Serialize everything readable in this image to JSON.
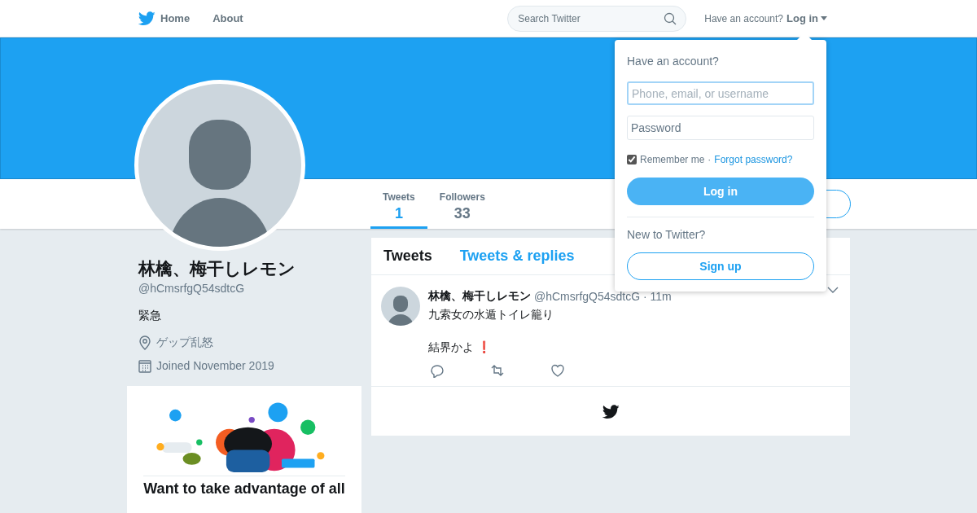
{
  "nav": {
    "items": [
      {
        "label": "Home",
        "kind": "home"
      },
      {
        "label": "About",
        "kind": "plain"
      }
    ],
    "search": {
      "placeholder": "Search Twitter"
    },
    "account_prompt": "Have an account?",
    "login_link": "Log in"
  },
  "profile": {
    "name": "林檎、梅干しレモン",
    "handle": "@hCmsrfgQ54sdtcG",
    "bio": "緊急",
    "location": "ゲップ乱怒",
    "joined": "Joined November 2019"
  },
  "stats": [
    {
      "label": "Tweets",
      "value": "1",
      "selected": true
    },
    {
      "label": "Followers",
      "value": "33",
      "selected": false
    }
  ],
  "promo": {
    "kind": "picture",
    "title": "Want to take advantage of all"
  },
  "timeline_tabs": [
    {
      "label": "Tweets",
      "selected": true
    },
    {
      "label": "Tweets & replies",
      "selected": false
    }
  ],
  "tweets": [
    {
      "name": "林檎、梅干しレモン",
      "handle": "@hCmsrfgQ54sdtcG",
      "time": "· 11m",
      "lines": [
        "九索女の水遁トイレ籠り",
        "結界かよ ❗"
      ]
    }
  ],
  "login_popup": {
    "heading": "Have an account?",
    "username": {
      "placeholder": "Phone, email, or username"
    },
    "password": {
      "placeholder": "Password"
    },
    "remember": {
      "label": "Remember me",
      "checked": true
    },
    "separator": "·",
    "forgot": "Forgot password?",
    "login_button": "Log in",
    "signup_prompt": "New to Twitter?",
    "signup_button": "Sign up"
  }
}
